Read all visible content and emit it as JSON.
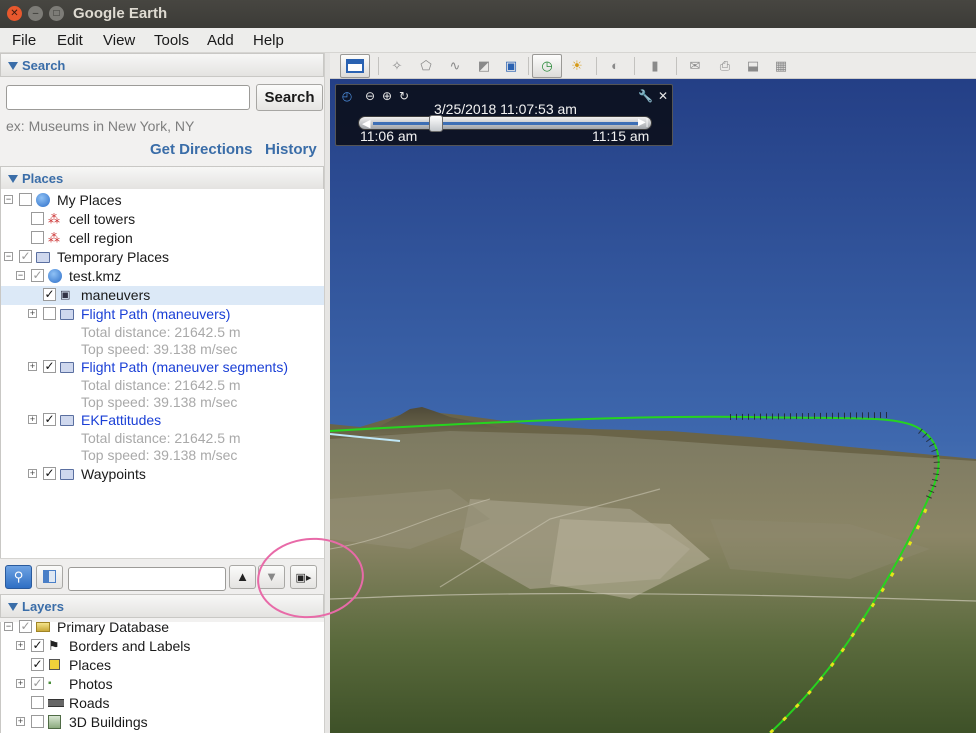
{
  "window": {
    "title": "Google Earth"
  },
  "menubar": [
    "File",
    "Edit",
    "View",
    "Tools",
    "Add",
    "Help"
  ],
  "search": {
    "header": "Search",
    "input_value": "",
    "button": "Search",
    "hint": "ex: Museums in New York, NY",
    "get_directions": "Get Directions",
    "history": "History"
  },
  "places": {
    "header": "Places",
    "items": [
      {
        "label": "My Places"
      },
      {
        "label": "cell towers"
      },
      {
        "label": "cell region"
      },
      {
        "label": "Temporary Places"
      },
      {
        "label": "test.kmz"
      },
      {
        "label": "maneuvers"
      },
      {
        "label": "Flight Path (maneuvers)",
        "sub1": "Total distance: 21642.5 m",
        "sub2": "Top speed: 39.138 m/sec"
      },
      {
        "label": "Flight Path (maneuver segments)",
        "sub1": "Total distance: 21642.5 m",
        "sub2": "Top speed: 39.138 m/sec"
      },
      {
        "label": "EKFattitudes",
        "sub1": "Total distance: 21642.5 m",
        "sub2": "Top speed: 39.138 m/sec"
      },
      {
        "label": "Waypoints"
      }
    ],
    "filter_value": ""
  },
  "layers": {
    "header": "Layers",
    "items": [
      {
        "label": "Primary Database"
      },
      {
        "label": "Borders and Labels"
      },
      {
        "label": "Places"
      },
      {
        "label": "Photos"
      },
      {
        "label": "Roads"
      },
      {
        "label": "3D Buildings"
      }
    ]
  },
  "time_slider": {
    "current": "3/25/2018  11:07:53 am",
    "start": "11:06 am",
    "end": "11:15 am",
    "position": 0.21
  },
  "colors": {
    "accent": "#3a6da8",
    "link_blue": "#1a3fd6",
    "flight_path": "#26d41f",
    "annotation": "#e86aa8"
  },
  "icons": {
    "toolbar": [
      "sidebar-toggle-icon",
      "placemark-icon",
      "polygon-icon",
      "path-icon",
      "overlay-icon",
      "tour-record-icon",
      "historical-imagery-icon",
      "sunlight-icon",
      "planets-icon",
      "ruler-icon",
      "email-icon",
      "print-icon",
      "save-image-icon",
      "view-in-maps-icon"
    ]
  }
}
